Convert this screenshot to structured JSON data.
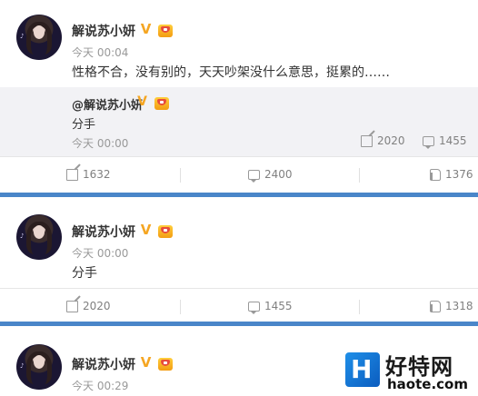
{
  "posts": [
    {
      "name": "解说苏小妍",
      "time": "今天 00:04",
      "text": "性格不合，没有别的，天天吵架没什么意思，挺累的……",
      "repost": {
        "name": "@解说苏小妍",
        "text": "分手",
        "time": "今天 00:00",
        "reposts": "2020",
        "comments": "1455"
      },
      "stats": {
        "reposts": "1632",
        "comments": "2400",
        "likes": "1376"
      }
    },
    {
      "name": "解说苏小妍",
      "time": "今天 00:00",
      "text": "分手",
      "stats": {
        "reposts": "2020",
        "comments": "1455",
        "likes": "1318"
      }
    },
    {
      "name": "解说苏小妍",
      "time": "今天 00:29"
    }
  ],
  "icons": {
    "verified": "v-badge-icon",
    "vip": "vip-crown-icon",
    "repost": "repost-icon",
    "comment": "comment-icon",
    "like": "thumbs-up-icon"
  },
  "colors": {
    "divider": "#4a86c9",
    "verified": "#f5a623",
    "watermark_blue": "#1f8fe8"
  },
  "watermark": {
    "title": "好特网",
    "url": "haote.com"
  }
}
